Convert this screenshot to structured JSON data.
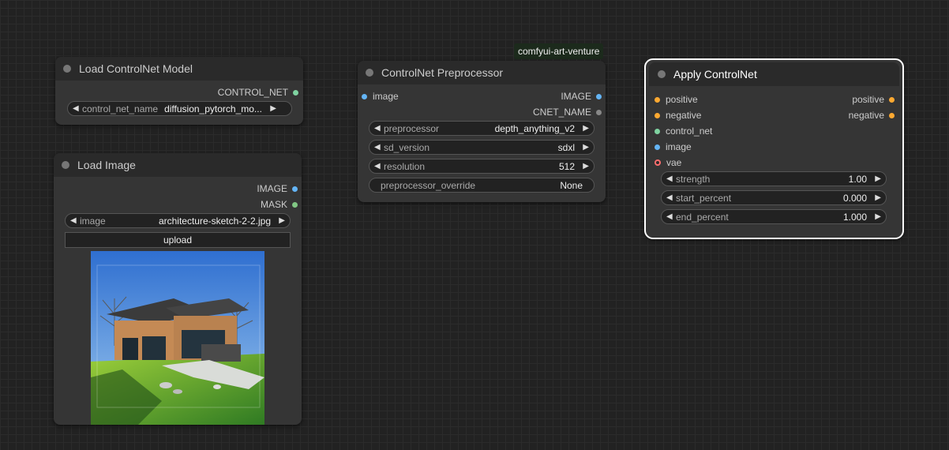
{
  "colors": {
    "background": "#222222",
    "node_bg": "#353535",
    "title_bg": "#2a2a2a",
    "image_dot": "#64b5f6",
    "controlnet_dot": "#7fd3a1",
    "mask_dot": "#81c784",
    "conditioning_dot": "#ffa931",
    "vae_dot": "#ff6e6e",
    "cnet_name_dot": "#888888"
  },
  "load_controlnet": {
    "title": "Load ControlNet Model",
    "output": "CONTROL_NET",
    "widget_label": "control_net_name",
    "widget_value": "diffusion_pytorch_mo..."
  },
  "load_image": {
    "title": "Load Image",
    "output_image": "IMAGE",
    "output_mask": "MASK",
    "widget_label": "image",
    "widget_value": "architecture-sketch-2-2.jpg",
    "upload_label": "upload",
    "preview_icon": "modern-house-photo"
  },
  "preprocessor": {
    "badge": "comfyui-art-venture",
    "title": "ControlNet Preprocessor",
    "input_image": "image",
    "output_image": "IMAGE",
    "output_cnet": "CNET_NAME",
    "preprocessor_label": "preprocessor",
    "preprocessor_value": "depth_anything_v2",
    "sd_version_label": "sd_version",
    "sd_version_value": "sdxl",
    "resolution_label": "resolution",
    "resolution_value": "512",
    "override_label": "preprocessor_override",
    "override_value": "None"
  },
  "apply_controlnet": {
    "title": "Apply ControlNet",
    "in_positive": "positive",
    "in_negative": "negative",
    "in_control_net": "control_net",
    "in_image": "image",
    "in_vae": "vae",
    "out_positive": "positive",
    "out_negative": "negative",
    "strength_label": "strength",
    "strength_value": "1.00",
    "start_label": "start_percent",
    "start_value": "0.000",
    "end_label": "end_percent",
    "end_value": "1.000"
  }
}
